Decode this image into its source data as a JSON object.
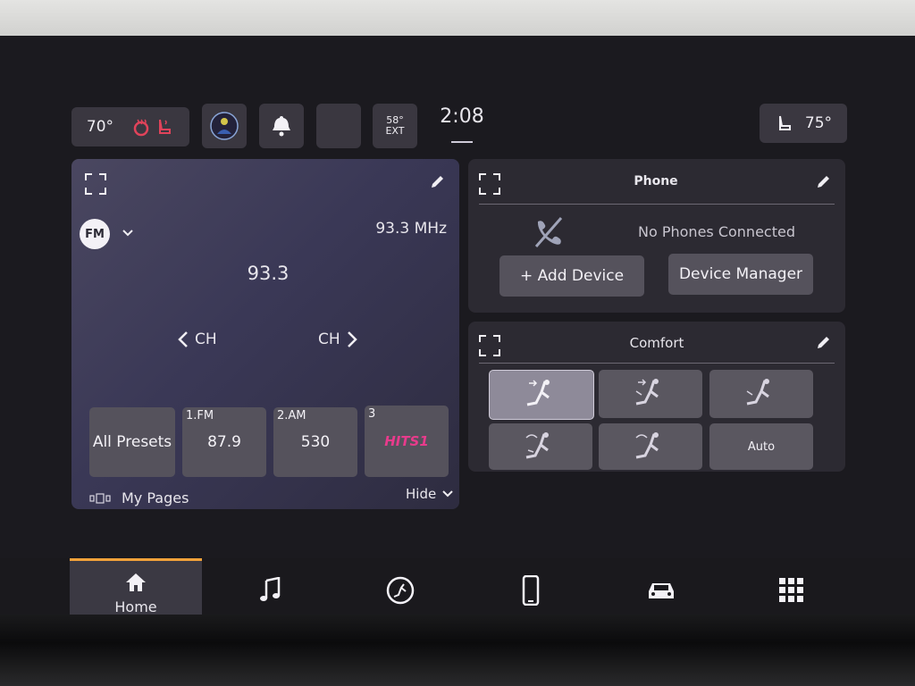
{
  "status_bar": {
    "left_temp": "70°",
    "ext_temp": "58°",
    "ext_label": "EXT",
    "clock": "2:08",
    "right_temp": "75°"
  },
  "radio": {
    "band": "FM",
    "frequency_display": "93.3 MHz",
    "station": "93.3",
    "ch_prev": "CH",
    "ch_next": "CH",
    "all_presets": "All Presets",
    "presets": [
      {
        "num": "1.FM",
        "value": "87.9"
      },
      {
        "num": "2.AM",
        "value": "530"
      },
      {
        "num": "3",
        "value": "HITS1"
      }
    ],
    "hide": "Hide"
  },
  "phone": {
    "title": "Phone",
    "status": "No Phones Connected",
    "add_device": "+ Add Device",
    "device_manager": "Device Manager"
  },
  "comfort": {
    "title": "Comfort",
    "auto": "Auto"
  },
  "my_pages": "My Pages",
  "nav": {
    "home": "Home"
  },
  "colors": {
    "accent": "#f2a23a",
    "heat": "#e0435a",
    "hits_pink": "#e83b8c"
  }
}
